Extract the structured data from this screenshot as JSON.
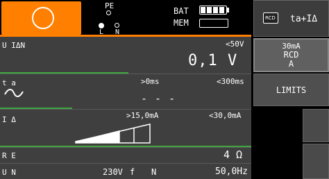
{
  "header": {
    "pe_label": "PE",
    "l_label": "L",
    "n_label": "N",
    "bat_label": "BAT",
    "mem_label": "MEM",
    "battery_level": 1.0
  },
  "right_panel": {
    "rcd_icon_text": "RCD",
    "mode_label": "ta+IΔ",
    "current_label": "30mA",
    "type_label": "RCD",
    "class_label": "A",
    "limits_label": "LIMITS"
  },
  "rows": {
    "u_ian": {
      "label": "U IΔN",
      "limit": "<50V",
      "value": "0,1 V"
    },
    "ta": {
      "label": "t a",
      "min": ">0ms",
      "max": "<300ms",
      "value": "- - -"
    },
    "i_delta": {
      "label": "I Δ",
      "min": ">15,0mA",
      "max": "<30,0mA"
    },
    "re": {
      "label": "R E",
      "value": "4 Ω"
    },
    "un": {
      "label": "U N",
      "voltage": "230V",
      "f_label": "f",
      "n_label": "N",
      "frequency": "50,0Hz"
    }
  },
  "colors": {
    "accent": "#ff7f00",
    "green": "#3fa63f",
    "panel_bg": "#3f3f3f"
  }
}
